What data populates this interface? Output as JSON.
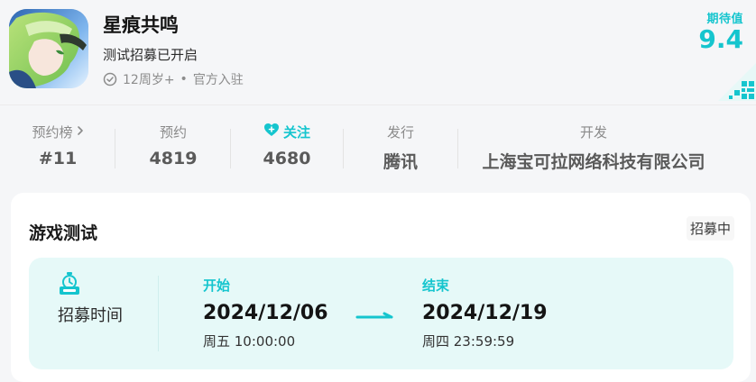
{
  "app": {
    "title": "星痕共鸣",
    "subtitle": "测试招募已开启",
    "age_rating": "12周岁+",
    "dot": "•",
    "official": "官方入驻"
  },
  "score": {
    "label": "期待值",
    "value": "9.4"
  },
  "stats": [
    {
      "key": "预约榜",
      "value": "#11"
    },
    {
      "key": "预约",
      "value": "4819"
    },
    {
      "key": "关注",
      "value": "4680"
    },
    {
      "key": "发行",
      "value": "腾讯"
    },
    {
      "key": "开发",
      "value": "上海宝可拉网络科技有限公司"
    }
  ],
  "test": {
    "section_title": "游戏测试",
    "status": "招募中",
    "recruit_label": "招募时间",
    "start": {
      "label": "开始",
      "date": "2024/12/06",
      "time": "周五 10:00:00"
    },
    "end": {
      "label": "结束",
      "date": "2024/12/19",
      "time": "周四 23:59:59"
    }
  },
  "colors": {
    "accent": "#15c5ce",
    "panel_bg": "#e6f9f8"
  },
  "icons": {
    "ok": "check-circle-icon",
    "follow": "heart-plus-icon",
    "arrow": "chevron-right-icon",
    "beta": "beta-clock-icon"
  }
}
